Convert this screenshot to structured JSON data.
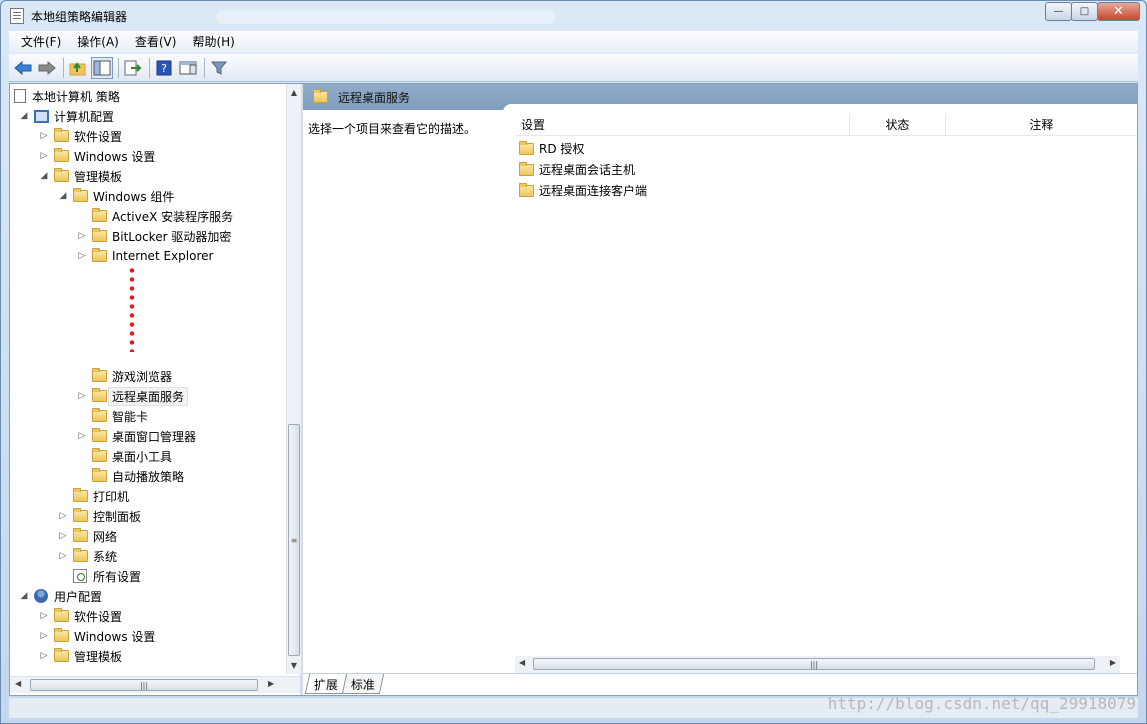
{
  "window": {
    "title": "本地组策略编辑器",
    "min": "—",
    "max": "□",
    "close": "✕"
  },
  "menu": [
    {
      "label": "文件(F)"
    },
    {
      "label": "操作(A)"
    },
    {
      "label": "查看(V)"
    },
    {
      "label": "帮助(H)"
    }
  ],
  "toolbar": {
    "back": "back-arrow-icon",
    "forward": "forward-arrow-icon",
    "up": "up-folder-icon",
    "show_hide_tree": "console-tree-icon",
    "export": "export-list-icon",
    "help": "help-icon",
    "show_pane": "action-pane-icon",
    "filter": "filter-icon"
  },
  "tree": {
    "root": "本地计算机 策略",
    "computer_config": "计算机配置",
    "cc_software": "软件设置",
    "cc_windows": "Windows 设置",
    "cc_admin": "管理模板",
    "win_components": "Windows 组件",
    "activex": "ActiveX 安装程序服务",
    "bitlocker": "BitLocker 驱动器加密",
    "ie": "Internet Explorer",
    "games": "游戏浏览器",
    "rds": "远程桌面服务",
    "smartcard": "智能卡",
    "dwm": "桌面窗口管理器",
    "gadgets": "桌面小工具",
    "autoplay": "自动播放策略",
    "printers": "打印机",
    "control_panel": "控制面板",
    "network": "网络",
    "system": "系统",
    "all_settings": "所有设置",
    "user_config": "用户配置",
    "uc_software": "软件设置",
    "uc_windows": "Windows 设置",
    "uc_admin": "管理模板"
  },
  "right": {
    "header": "远程桌面服务",
    "description": "选择一个项目来查看它的描述。",
    "columns": {
      "setting": "设置",
      "state": "状态",
      "comment": "注释"
    },
    "items": [
      {
        "label": "RD 授权"
      },
      {
        "label": "远程桌面会话主机"
      },
      {
        "label": "远程桌面连接客户端"
      }
    ]
  },
  "tabs": {
    "extended": "扩展",
    "standard": "标准"
  },
  "watermark": "http://blog.csdn.net/qq_29918079",
  "colors": {
    "header": "#8aa7c6",
    "folder": "#eec65a",
    "annotation": "#e41b1b"
  }
}
